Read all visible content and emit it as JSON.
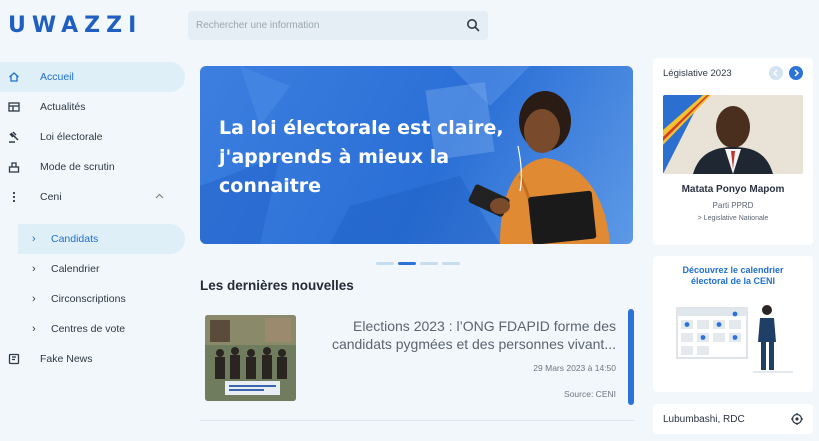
{
  "brand": {
    "logo": "UWAZZI"
  },
  "search": {
    "placeholder": "Rechercher une information"
  },
  "sidebar": {
    "items": [
      {
        "label": "Accueil"
      },
      {
        "label": "Actualités"
      },
      {
        "label": "Loi électorale"
      },
      {
        "label": "Mode de scrutin"
      },
      {
        "label": "Ceni"
      }
    ],
    "subitems": [
      {
        "label": "Candidats"
      },
      {
        "label": "Calendrier"
      },
      {
        "label": "Circonscriptions"
      },
      {
        "label": "Centres de vote"
      }
    ],
    "fake_news": "Fake News"
  },
  "hero": {
    "line1": "La loi électorale est claire,",
    "line2": "j'apprends à mieux la",
    "line3": "connaitre"
  },
  "news": {
    "section_title": "Les dernières nouvelles",
    "items": [
      {
        "headline": "Elections 2023 : l’ONG FDAPID forme des candidats pygmées et des personnes vivant...",
        "date": "29 Mars 2023 à 14:50",
        "source": "Source: CENI"
      }
    ]
  },
  "candidate_card": {
    "header": "Législative 2023",
    "name": "Matata Ponyo Mapom",
    "party": "Parti PPRD",
    "election": "> Legislative Nationale"
  },
  "calendar_card": {
    "title": "Découvrez le calendrier électoral de la CENI"
  },
  "location_card": {
    "label": "Lubumbashi, RDC"
  },
  "colors": {
    "accent": "#2c73d8",
    "background": "#f1f7fb",
    "active_nav": "#dfeff7"
  }
}
